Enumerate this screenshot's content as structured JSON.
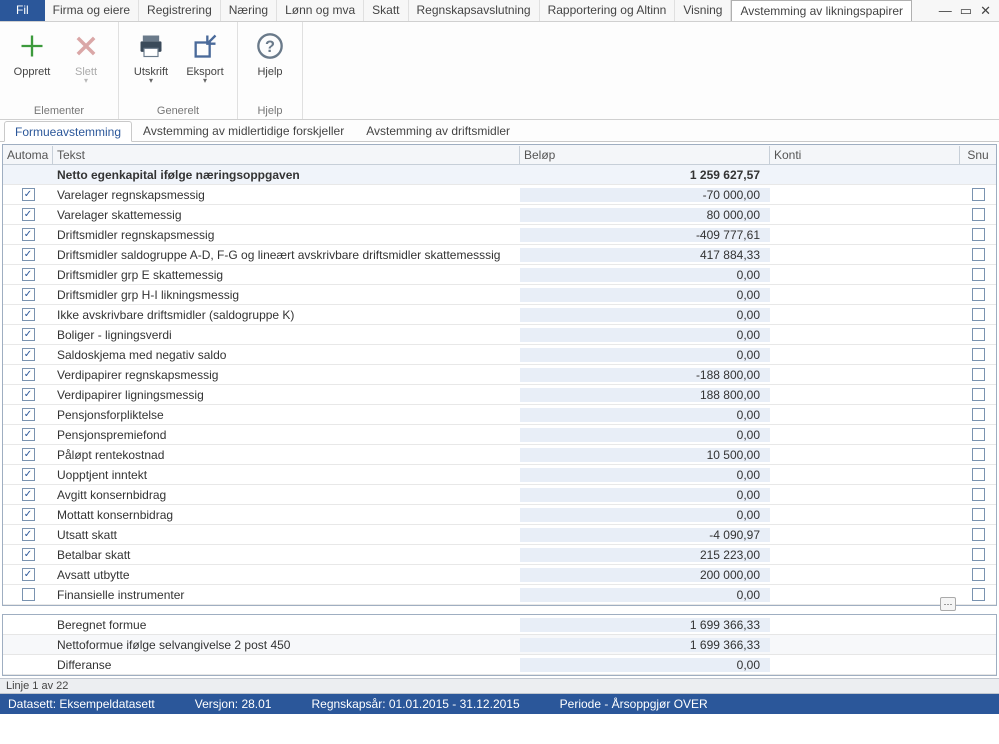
{
  "menu": {
    "file": "Fil",
    "items": [
      "Firma og eiere",
      "Registrering",
      "Næring",
      "Lønn og mva",
      "Skatt",
      "Regnskapsavslutning",
      "Rapportering og Altinn",
      "Visning",
      "Avstemming av likningspapirer"
    ],
    "active_index": 8
  },
  "ribbon": {
    "groups": [
      {
        "label": "Elementer",
        "buttons": [
          {
            "name": "opprett",
            "label": "Opprett",
            "icon": "plus",
            "disabled": false
          },
          {
            "name": "slett",
            "label": "Slett",
            "icon": "x",
            "disabled": true,
            "dropdown": true
          }
        ]
      },
      {
        "label": "Generelt",
        "buttons": [
          {
            "name": "utskrift",
            "label": "Utskrift",
            "icon": "printer",
            "disabled": false,
            "dropdown": true
          },
          {
            "name": "eksport",
            "label": "Eksport",
            "icon": "export",
            "disabled": false,
            "dropdown": true
          }
        ]
      },
      {
        "label": "Hjelp",
        "buttons": [
          {
            "name": "hjelp",
            "label": "Hjelp",
            "icon": "help",
            "disabled": false
          }
        ]
      }
    ]
  },
  "subtabs": {
    "items": [
      "Formueavstemming",
      "Avstemming av midlertidige forskjeller",
      "Avstemming av driftsmidler"
    ],
    "active_index": 0
  },
  "grid": {
    "columns": {
      "automa": "Automa",
      "tekst": "Tekst",
      "belop": "Beløp",
      "konti": "Konti",
      "snu": "Snu"
    },
    "rows": [
      {
        "header": true,
        "tekst": "Netto egenkapital ifølge næringsoppgaven",
        "belop": "1 259 627,57"
      },
      {
        "automa": true,
        "tekst": "Varelager regnskapsmessig",
        "belop": "-70 000,00",
        "snu": false
      },
      {
        "automa": true,
        "tekst": "Varelager skattemessig",
        "belop": "80 000,00",
        "snu": false
      },
      {
        "automa": true,
        "tekst": "Driftsmidler regnskapsmessig",
        "belop": "-409 777,61",
        "snu": false
      },
      {
        "automa": true,
        "tekst": "Driftsmidler saldogruppe A-D, F-G og lineært avskrivbare driftsmidler skattemesssig",
        "belop": "417 884,33",
        "snu": false
      },
      {
        "automa": true,
        "tekst": "Driftsmidler grp E skattemessig",
        "belop": "0,00",
        "snu": false
      },
      {
        "automa": true,
        "tekst": "Driftsmidler grp H-I likningsmessig",
        "belop": "0,00",
        "snu": false
      },
      {
        "automa": true,
        "tekst": "Ikke avskrivbare driftsmidler (saldogruppe K)",
        "belop": "0,00",
        "snu": false
      },
      {
        "automa": true,
        "tekst": "Boliger - ligningsverdi",
        "belop": "0,00",
        "snu": false
      },
      {
        "automa": true,
        "tekst": "Saldoskjema med negativ saldo",
        "belop": "0,00",
        "snu": false
      },
      {
        "automa": true,
        "tekst": "Verdipapirer regnskapsmessig",
        "belop": "-188 800,00",
        "snu": false
      },
      {
        "automa": true,
        "tekst": "Verdipapirer ligningsmessig",
        "belop": "188 800,00",
        "snu": false
      },
      {
        "automa": true,
        "tekst": "Pensjonsforpliktelse",
        "belop": "0,00",
        "snu": false
      },
      {
        "automa": true,
        "tekst": "Pensjonspremiefond",
        "belop": "0,00",
        "snu": false
      },
      {
        "automa": true,
        "tekst": "Påløpt rentekostnad",
        "belop": "10 500,00",
        "snu": false
      },
      {
        "automa": true,
        "tekst": "Uopptjent inntekt",
        "belop": "0,00",
        "snu": false
      },
      {
        "automa": true,
        "tekst": "Avgitt konsernbidrag",
        "belop": "0,00",
        "snu": false
      },
      {
        "automa": true,
        "tekst": "Mottatt konsernbidrag",
        "belop": "0,00",
        "snu": false
      },
      {
        "automa": true,
        "tekst": "Utsatt skatt",
        "belop": "-4 090,97",
        "snu": false
      },
      {
        "automa": true,
        "tekst": "Betalbar skatt",
        "belop": "215 223,00",
        "snu": false
      },
      {
        "automa": true,
        "tekst": "Avsatt utbytte",
        "belop": "200 000,00",
        "snu": false
      },
      {
        "automa": false,
        "tekst": "Finansielle instrumenter",
        "belop": "0,00",
        "konti_btn": true,
        "snu": false
      }
    ]
  },
  "summary": [
    {
      "tekst": "Beregnet formue",
      "belop": "1 699 366,33"
    },
    {
      "tekst": "Nettoformue ifølge selvangivelse 2 post 450",
      "belop": "1 699 366,33"
    },
    {
      "tekst": "Differanse",
      "belop": "0,00"
    }
  ],
  "linecount": "Linje 1 av 22",
  "status": {
    "dataset": "Datasett: Eksempeldatasett",
    "version": "Versjon: 28.01",
    "year": "Regnskapsår: 01.01.2015 - 31.12.2015",
    "period": "Periode - Årsoppgjør  OVER"
  }
}
